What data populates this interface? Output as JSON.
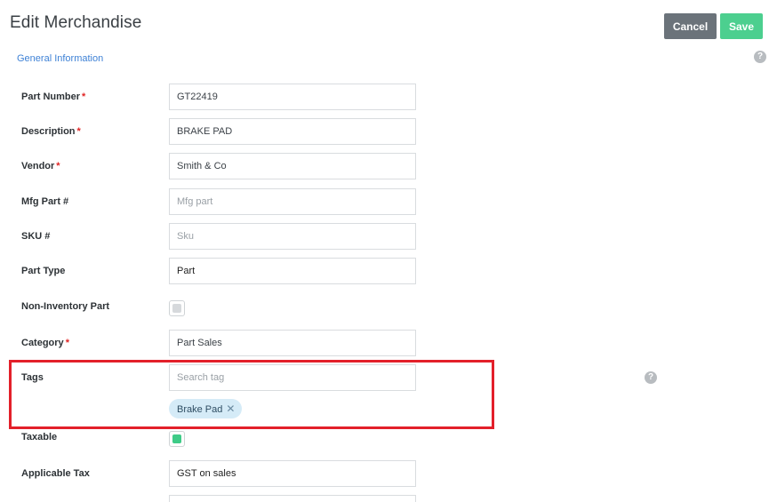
{
  "header": {
    "title": "Edit Merchandise",
    "cancel_label": "Cancel",
    "save_label": "Save"
  },
  "section": {
    "label": "General Information",
    "help_icon": "question-circle-icon"
  },
  "fields": {
    "part_number": {
      "label": "Part Number",
      "value": "GT22419"
    },
    "description": {
      "label": "Description",
      "value": "BRAKE PAD"
    },
    "vendor": {
      "label": "Vendor",
      "value": "Smith & Co"
    },
    "mfg_part": {
      "label": "Mfg Part #",
      "placeholder": "Mfg part"
    },
    "sku": {
      "label": "SKU #",
      "placeholder": "Sku"
    },
    "part_type": {
      "label": "Part Type",
      "value": "Part"
    },
    "non_inventory": {
      "label": "Non-Inventory Part",
      "checked": false
    },
    "category": {
      "label": "Category",
      "value": "Part Sales"
    },
    "tags": {
      "label": "Tags",
      "placeholder": "Search tag",
      "chips": [
        "Brake Pad"
      ]
    },
    "taxable": {
      "label": "Taxable",
      "checked": true
    },
    "applicable_tax": {
      "label": "Applicable Tax",
      "value": "GST on sales"
    }
  },
  "required_marker": "*",
  "colors": {
    "accent_link": "#3f82d6",
    "save": "#4ccf8f",
    "cancel": "#6b737a",
    "highlight": "#e3202a",
    "chip_bg": "#d5ebf7",
    "required": "#e02424"
  }
}
